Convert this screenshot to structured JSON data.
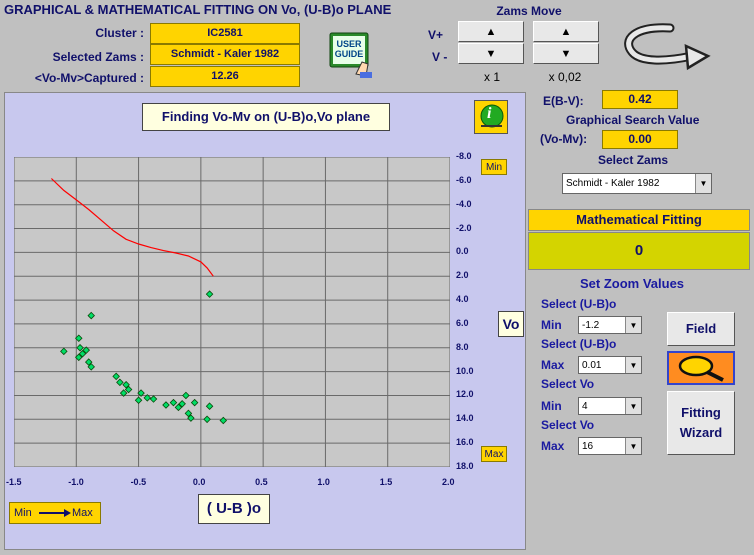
{
  "title": "GRAPHICAL & MATHEMATICAL FITTING ON Vo, (U-B)o PLANE",
  "info": {
    "cluster_label": "Cluster :",
    "cluster_value": "IC2581",
    "zams_label": "Selected Zams :",
    "zams_value": "Schmidt - Kaler 1982",
    "vomv_label": "<Vo-Mv>Captured :",
    "vomv_value": "12.26"
  },
  "zams_move": {
    "title": "Zams Move",
    "vplus": "V+",
    "vminus": "V -",
    "up": "▲",
    "down": "▼",
    "scale1": "x 1",
    "scale2": "x 0,02"
  },
  "user_guide": "USER GUIDE",
  "plot_title": "Finding Vo-Mv on (U-B)o,Vo plane",
  "info_icon_glyph": "i",
  "badges": {
    "min": "Min",
    "max": "Max",
    "vo": "Vo",
    "xlabel": "( U-B )o",
    "legend_min": "Min",
    "legend_max": "Max"
  },
  "right": {
    "ebv_label": "E(B-V):",
    "ebv_value": "0.42",
    "gsv_title": "Graphical Search Value",
    "vomv_label": "(Vo-Mv):",
    "vomv_value": "0.00",
    "select_zams_label": "Select Zams",
    "select_zams_value": "Schmidt - Kaler 1982",
    "math_fitting_label": "Mathematical Fitting",
    "math_fitting_value": "0",
    "zoom_title": "Set Zoom Values",
    "sel_ub_1": "Select (U-B)o",
    "min_label": "Min",
    "min_ub": "-1.2",
    "sel_ub_2": "Select (U-B)o",
    "max_label": "Max",
    "max_ub": "0.01",
    "sel_vo_1": "Select Vo",
    "min_label2": "Min",
    "min_vo": "4",
    "sel_vo_2": "Select Vo",
    "max_label2": "Max",
    "max_vo": "16",
    "field_button": "Field",
    "fitting_line1": "Fitting",
    "fitting_line2": "Wizard"
  },
  "colors": {
    "accent": "#ffd400",
    "text": "#10106a",
    "zams": "#ff0000",
    "points": "#00dd66",
    "panel": "#c8c8ee"
  },
  "chart_data": {
    "type": "scatter",
    "xlim": [
      -1.5,
      2.0
    ],
    "ylim": [
      -8.0,
      18.0
    ],
    "y_inverted": true,
    "xticks": [
      "-1.5",
      "-1.0",
      "-0.5",
      "0.0",
      "0.5",
      "1.0",
      "1.5",
      "2.0"
    ],
    "yticks": [
      "-8.0",
      "-6.0",
      "-4.0",
      "-2.0",
      "0.0",
      "2.0",
      "4.0",
      "6.0",
      "8.0",
      "10.0",
      "12.0",
      "14.0",
      "16.0",
      "18.0"
    ],
    "zams_curve": [
      [
        -1.2,
        -6.2
      ],
      [
        -1.1,
        -5.2
      ],
      [
        -1.0,
        -4.4
      ],
      [
        -0.9,
        -3.6
      ],
      [
        -0.8,
        -2.7
      ],
      [
        -0.7,
        -1.8
      ],
      [
        -0.6,
        -1.1
      ],
      [
        -0.5,
        -0.7
      ],
      [
        -0.4,
        -0.4
      ],
      [
        -0.3,
        -0.15
      ],
      [
        -0.2,
        0.05
      ],
      [
        -0.1,
        0.3
      ],
      [
        0.0,
        0.8
      ],
      [
        0.05,
        1.3
      ],
      [
        0.1,
        2.0
      ]
    ],
    "points": [
      [
        0.07,
        3.5
      ],
      [
        -0.88,
        5.3
      ],
      [
        -0.98,
        7.2
      ],
      [
        -1.1,
        8.3
      ],
      [
        -0.97,
        8.0
      ],
      [
        -0.95,
        8.5
      ],
      [
        -0.92,
        8.2
      ],
      [
        -0.98,
        8.8
      ],
      [
        -0.9,
        9.2
      ],
      [
        -0.88,
        9.6
      ],
      [
        -0.68,
        10.4
      ],
      [
        -0.65,
        10.9
      ],
      [
        -0.6,
        11.1
      ],
      [
        -0.62,
        11.8
      ],
      [
        -0.58,
        11.5
      ],
      [
        -0.48,
        11.8
      ],
      [
        -0.5,
        12.4
      ],
      [
        -0.43,
        12.2
      ],
      [
        -0.38,
        12.3
      ],
      [
        -0.28,
        12.8
      ],
      [
        -0.22,
        12.6
      ],
      [
        -0.18,
        13.0
      ],
      [
        -0.15,
        12.7
      ],
      [
        -0.12,
        12.0
      ],
      [
        -0.1,
        13.5
      ],
      [
        -0.08,
        13.9
      ],
      [
        -0.05,
        12.6
      ],
      [
        0.07,
        12.9
      ],
      [
        0.05,
        14.0
      ],
      [
        0.18,
        14.1
      ]
    ]
  }
}
